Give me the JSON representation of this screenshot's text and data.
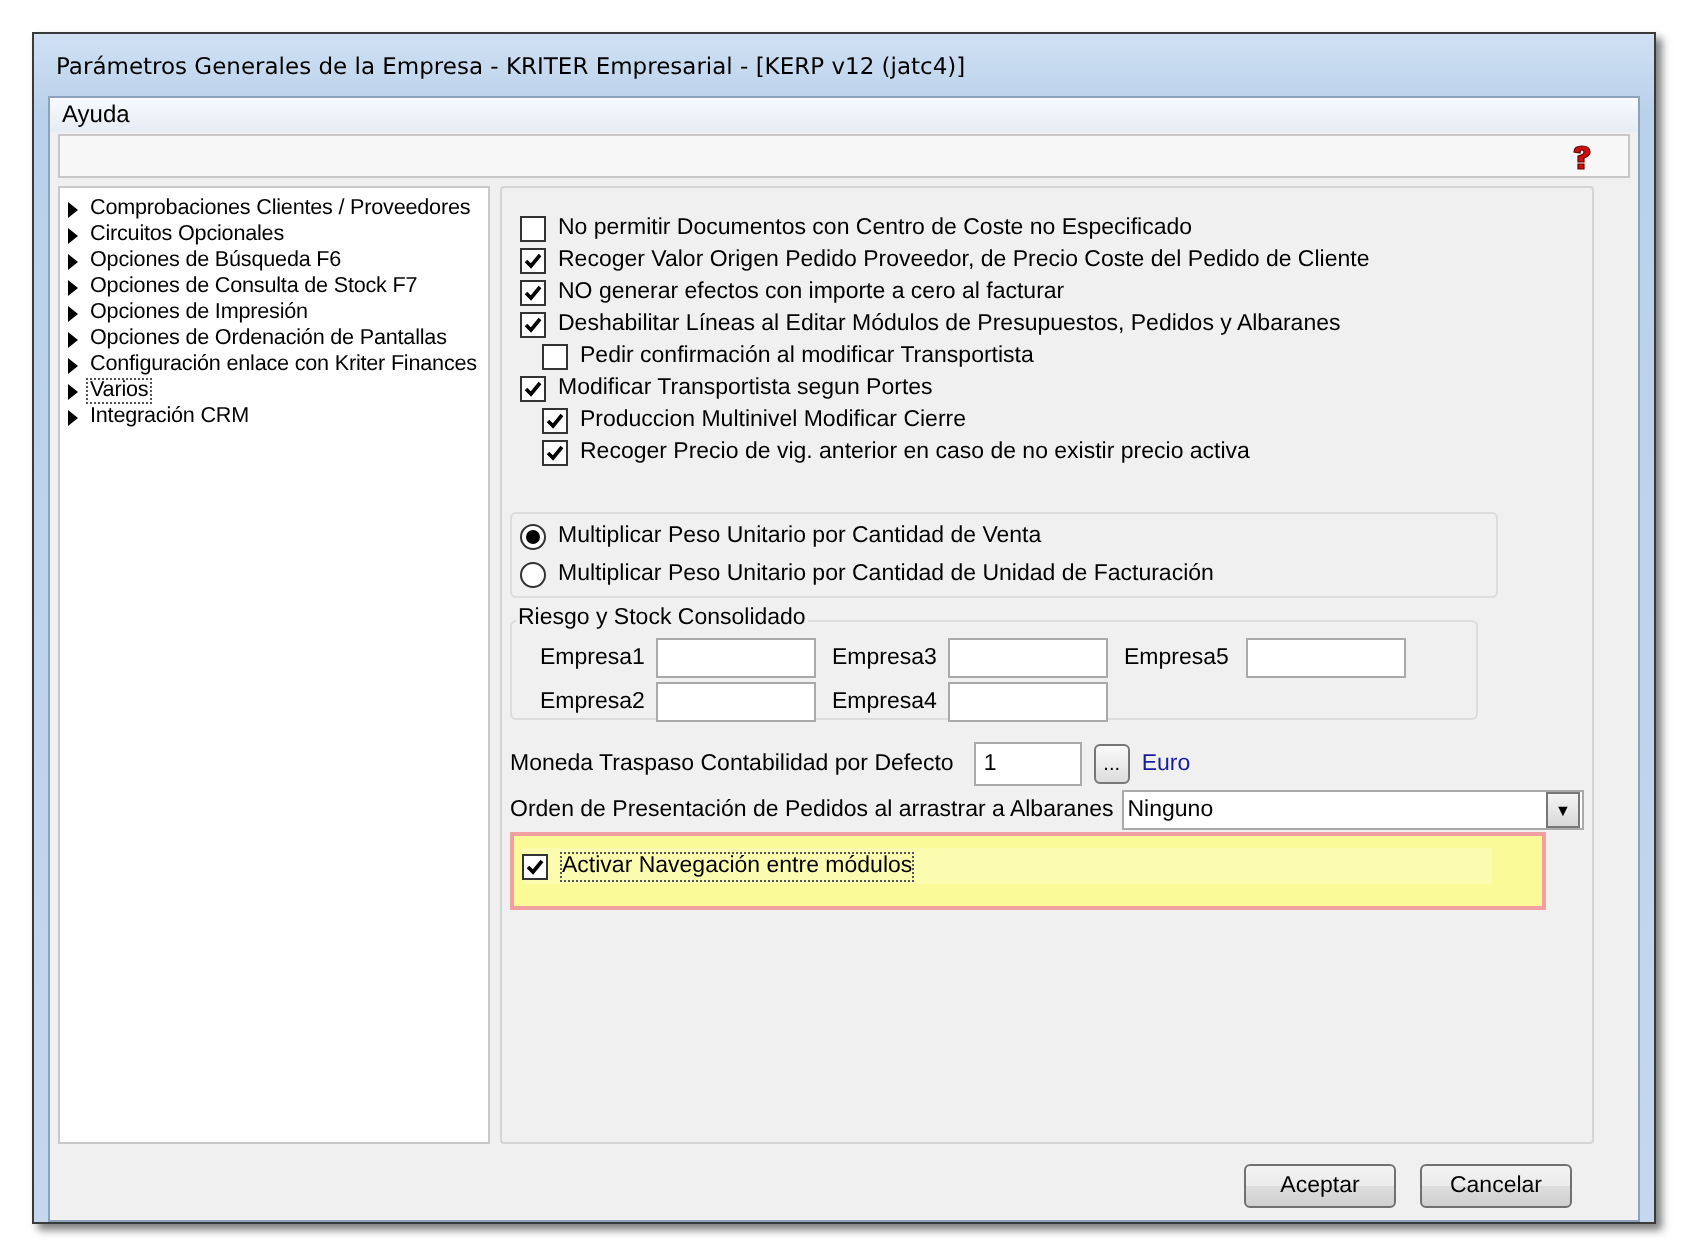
{
  "window": {
    "title": "Parámetros Generales de la Empresa - KRITER Empresarial - [KERP v12 (jatc4)]"
  },
  "menu": [
    "Ayuda"
  ],
  "tree": [
    {
      "label": "Comprobaciones Clientes / Proveedores",
      "selected": false
    },
    {
      "label": "Circuitos Opcionales",
      "selected": false
    },
    {
      "label": "Opciones de Búsqueda F6",
      "selected": false
    },
    {
      "label": "Opciones de Consulta de Stock F7",
      "selected": false
    },
    {
      "label": "Opciones de Impresión",
      "selected": false
    },
    {
      "label": "Opciones de Ordenación de Pantallas",
      "selected": false
    },
    {
      "label": "Configuración enlace con Kriter Finances",
      "selected": false
    },
    {
      "label": "Varios",
      "selected": true
    },
    {
      "label": "Integración CRM",
      "selected": false
    }
  ],
  "options": [
    {
      "label": "No permitir Documentos con Centro de Coste no Especificado",
      "checked": false
    },
    {
      "label": "Recoger Valor Origen Pedido Proveedor, de Precio Coste del Pedido de Cliente",
      "checked": true
    },
    {
      "label": "NO generar efectos con importe a cero al facturar",
      "checked": true
    },
    {
      "label": "Deshabilitar Líneas al Editar Módulos de Presupuestos, Pedidos y Albaranes",
      "checked": true,
      "children": [
        {
          "label": "Pedir confirmación al modificar Transportista",
          "checked": false
        }
      ]
    },
    {
      "label": "Modificar Transportista segun Portes",
      "checked": true,
      "children": [
        {
          "label": "Produccion Multinivel Modificar Cierre",
          "checked": true
        },
        {
          "label": "Recoger Precio de vig. anterior en caso de no existir precio activa",
          "checked": true
        }
      ]
    }
  ],
  "weight_mode": [
    {
      "label": "Multiplicar Peso Unitario por Cantidad de Venta",
      "selected": true
    },
    {
      "label": "Multiplicar Peso Unitario por Cantidad de Unidad de Facturación",
      "selected": false
    }
  ],
  "risk_group": {
    "title": "Riesgo y Stock Consolidado",
    "columns": [
      [
        {
          "label": "Empresa1"
        },
        {
          "label": "Empresa2"
        }
      ],
      [
        {
          "label": "Empresa3"
        },
        {
          "label": "Empresa4"
        }
      ],
      [
        {
          "label": "Empresa5"
        }
      ]
    ]
  },
  "currency": {
    "label": "Moneda Traspaso Contabilidad por Defecto",
    "value": "1",
    "browse": "...",
    "name": "Euro"
  },
  "order": {
    "label": "Orden de Presentación de Pedidos al arrastrar a Albaranes",
    "value": "Ninguno",
    "arrow": "▼"
  },
  "navigation": {
    "label": "Activar Navegación entre módulos",
    "checked": true
  },
  "buttons": [
    "Aceptar",
    "Cancelar"
  ]
}
